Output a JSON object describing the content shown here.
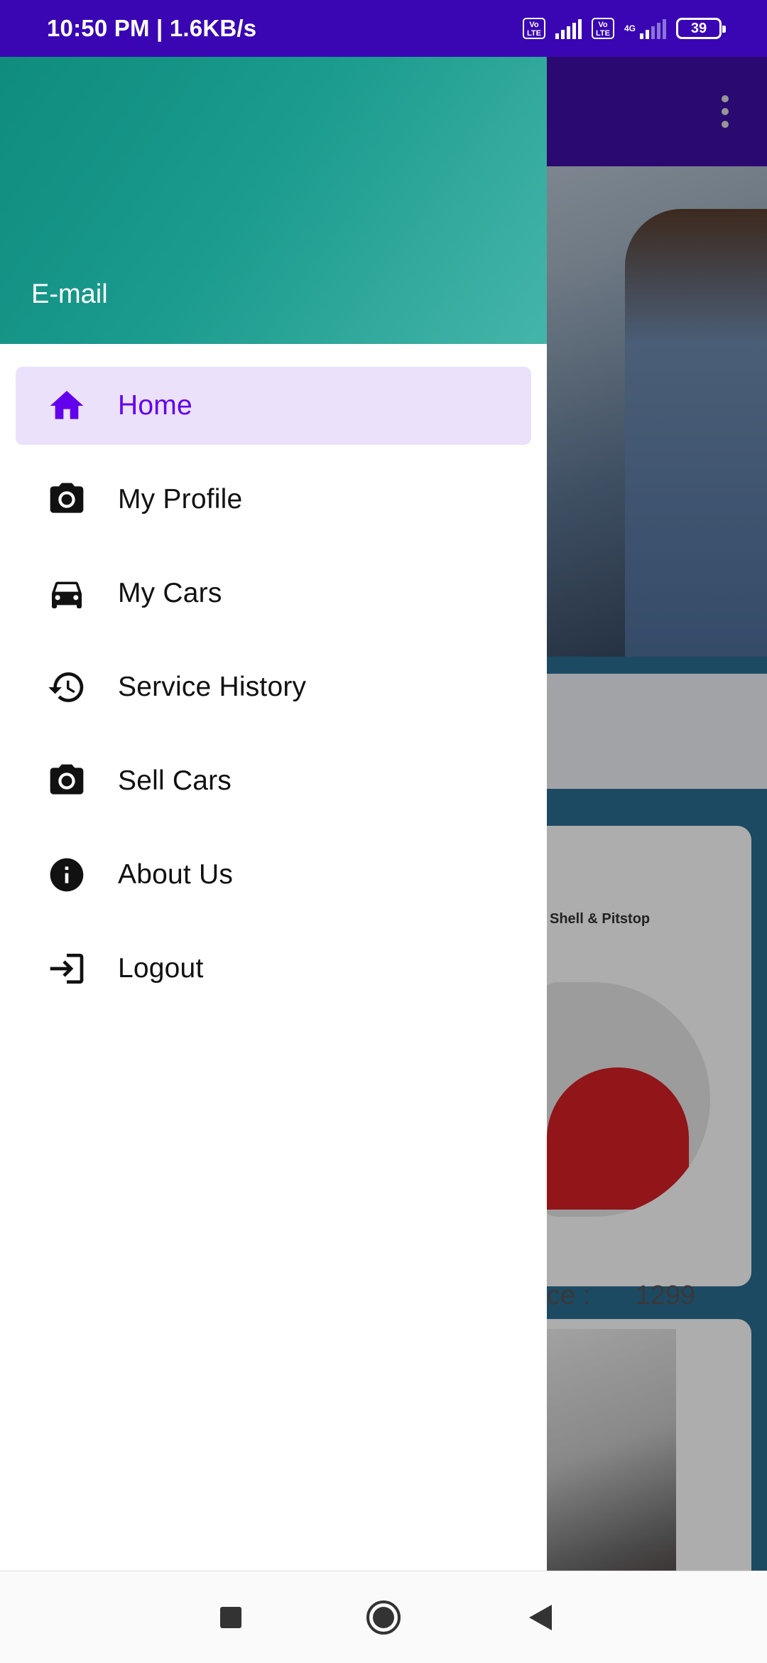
{
  "status_bar": {
    "time_speed": "10:50 PM | 1.6KB/s",
    "volte1": "Vo LTE",
    "volte2": "Vo LTE",
    "network": "4G",
    "battery": "39"
  },
  "background": {
    "brand_text": "Shell  &  Pitstop",
    "price_label": "ce :",
    "price_value": "1299"
  },
  "drawer": {
    "header_email": "E-mail",
    "items": [
      {
        "label": "Home",
        "icon": "home-icon",
        "active": true
      },
      {
        "label": "My Profile",
        "icon": "camera-icon"
      },
      {
        "label": "My Cars",
        "icon": "car-icon"
      },
      {
        "label": "Service History",
        "icon": "history-icon"
      },
      {
        "label": "Sell Cars",
        "icon": "camera-icon"
      },
      {
        "label": "About Us",
        "icon": "info-icon"
      },
      {
        "label": "Logout",
        "icon": "logout-icon"
      }
    ]
  },
  "colors": {
    "status_bar": "#3a06b4",
    "accent": "#6200ee",
    "active_item_bg": "#ebe1fb",
    "header_gradient_start": "#0f8c7e",
    "header_gradient_end": "#45b5a9"
  },
  "nav_bar": {
    "buttons": [
      "recents-icon",
      "home-button-icon",
      "back-icon"
    ]
  }
}
